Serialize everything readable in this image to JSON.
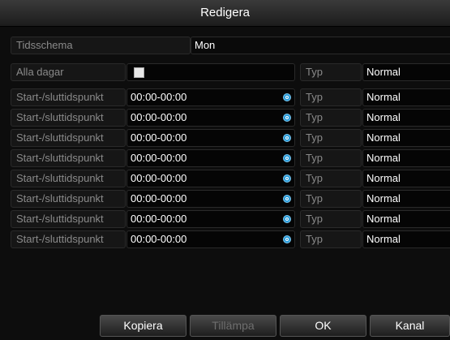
{
  "window": {
    "title": "Redigera"
  },
  "schedule": {
    "label": "Tidsschema",
    "value": "Mon"
  },
  "all_days": {
    "label": "Alla dagar",
    "type_label": "Typ",
    "type_value": "Normal"
  },
  "periods": [
    {
      "label": "Start-/sluttidspunkt",
      "time": "00:00-00:00",
      "type_label": "Typ",
      "type_value": "Normal"
    },
    {
      "label": "Start-/sluttidspunkt",
      "time": "00:00-00:00",
      "type_label": "Typ",
      "type_value": "Normal"
    },
    {
      "label": "Start-/sluttidspunkt",
      "time": "00:00-00:00",
      "type_label": "Typ",
      "type_value": "Normal"
    },
    {
      "label": "Start-/sluttidspunkt",
      "time": "00:00-00:00",
      "type_label": "Typ",
      "type_value": "Normal"
    },
    {
      "label": "Start-/sluttidspunkt",
      "time": "00:00-00:00",
      "type_label": "Typ",
      "type_value": "Normal"
    },
    {
      "label": "Start-/sluttidspunkt",
      "time": "00:00-00:00",
      "type_label": "Typ",
      "type_value": "Normal"
    },
    {
      "label": "Start-/sluttidspunkt",
      "time": "00:00-00:00",
      "type_label": "Typ",
      "type_value": "Normal"
    },
    {
      "label": "Start-/sluttidspunkt",
      "time": "00:00-00:00",
      "type_label": "Typ",
      "type_value": "Normal"
    }
  ],
  "buttons": {
    "copy": "Kopiera",
    "apply": "Tillämpa",
    "ok": "OK",
    "cancel": "Kanal"
  },
  "icons": {
    "clock": "clock-icon",
    "dropdown": "chevron-down-icon"
  },
  "colors": {
    "accent": "#2a9bd8",
    "background": "#0d0d0d"
  }
}
